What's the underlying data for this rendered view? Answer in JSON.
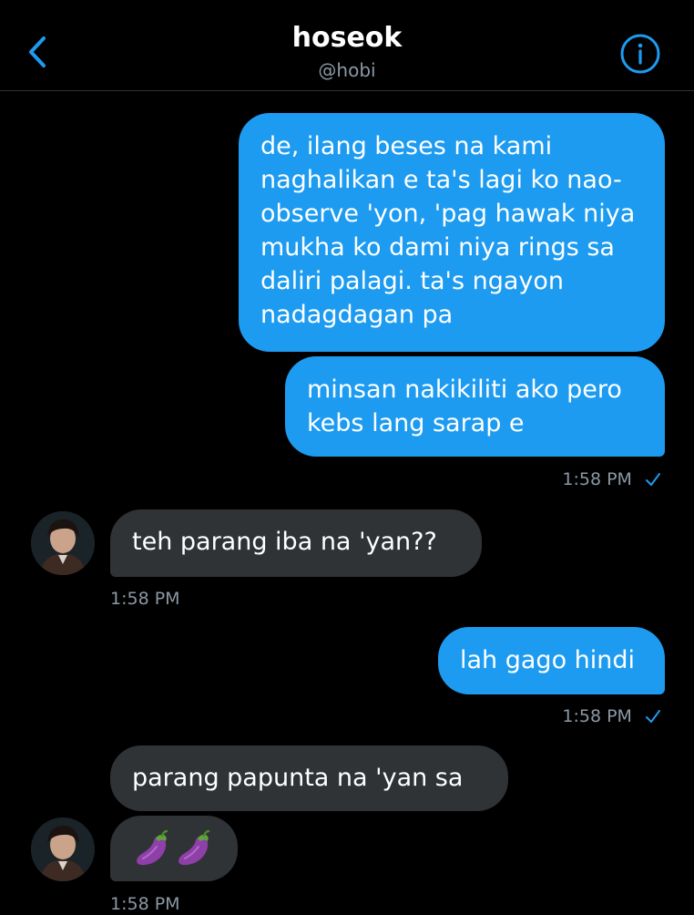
{
  "header": {
    "name": "hoseok",
    "handle": "@hobi",
    "back_icon": "chevron-left-icon",
    "info_icon": "info-icon"
  },
  "colors": {
    "background": "#000000",
    "outgoing_bubble": "#1d9bf0",
    "incoming_bubble": "#2f3336",
    "timestamp": "#8b98a5",
    "accent": "#1d9bf0"
  },
  "messages": [
    {
      "direction": "outgoing",
      "text": "de, ilang beses na kami naghalikan e ta's lagi ko nao-observe 'yon, 'pag hawak niya mukha ko dami niya rings sa daliri palagi. ta's ngayon nadagdagan pa"
    },
    {
      "direction": "outgoing",
      "text": "minsan nakikiliti ako pero kebs lang sarap e"
    },
    {
      "direction": "incoming",
      "text": "teh parang iba na 'yan??"
    },
    {
      "direction": "outgoing",
      "text": "lah gago hindi"
    },
    {
      "direction": "incoming",
      "text": "parang papunta na 'yan sa"
    },
    {
      "direction": "incoming",
      "text": "🍆🍆",
      "emoji_icon": "eggplant-icon"
    }
  ],
  "timestamps": {
    "t1": "1:58 PM",
    "t2": "1:58 PM",
    "t3": "1:58 PM",
    "t4": "1:58 PM"
  }
}
